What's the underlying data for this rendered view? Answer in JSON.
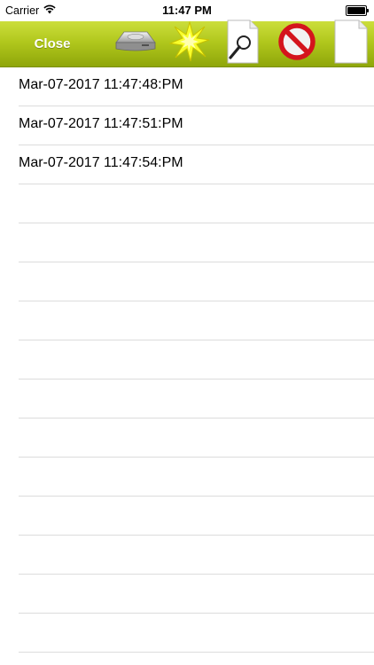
{
  "status_bar": {
    "carrier": "Carrier",
    "time": "11:47 PM",
    "wifi_icon": "wifi-icon",
    "battery_icon": "battery-icon"
  },
  "toolbar": {
    "close_label": "Close",
    "background": "#b1c81d",
    "buttons": [
      {
        "icon": "disk-drive-icon"
      },
      {
        "icon": "starburst-icon"
      },
      {
        "icon": "document-search-icon"
      },
      {
        "icon": "no-sign-icon"
      },
      {
        "icon": "blank-document-icon"
      }
    ]
  },
  "list": {
    "items": [
      "Mar-07-2017 11:47:48:PM",
      "Mar-07-2017 11:47:51:PM",
      "Mar-07-2017 11:47:54:PM",
      "",
      "",
      "",
      "",
      "",
      "",
      "",
      "",
      "",
      "",
      "",
      "",
      ""
    ]
  }
}
